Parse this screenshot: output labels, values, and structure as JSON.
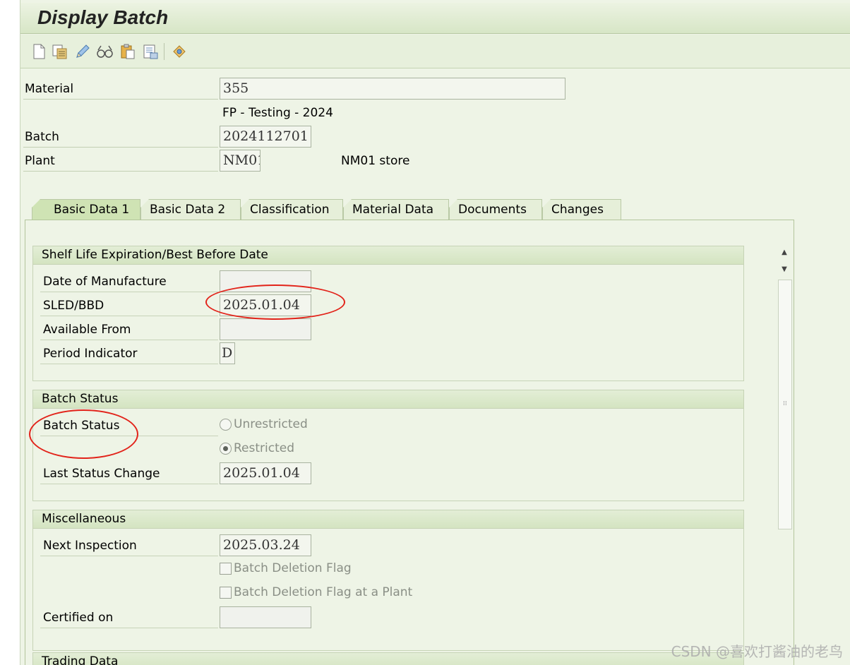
{
  "window": {
    "title": "Display Batch"
  },
  "toolbar": {
    "icons": [
      "new-document-icon",
      "copy-icon",
      "edit-pencil-icon",
      "display-glasses-icon",
      "paste-icon",
      "print-list-icon",
      "settings-icon"
    ]
  },
  "header": {
    "material_label": "Material",
    "material_value": "355",
    "material_desc": "FP - Testing - 2024",
    "batch_label": "Batch",
    "batch_value": "2024112701",
    "plant_label": "Plant",
    "plant_value": "NM01",
    "plant_desc": "NM01 store"
  },
  "tabs": [
    {
      "label": "Basic Data 1",
      "active": true
    },
    {
      "label": "Basic Data 2",
      "active": false
    },
    {
      "label": "Classification",
      "active": false
    },
    {
      "label": "Material Data",
      "active": false
    },
    {
      "label": "Documents",
      "active": false
    },
    {
      "label": "Changes",
      "active": false
    }
  ],
  "shelf_life": {
    "title": "Shelf Life Expiration/Best Before Date",
    "manufacture_label": "Date of Manufacture",
    "manufacture_value": "",
    "sled_label": "SLED/BBD",
    "sled_value": "2025.01.04",
    "available_label": "Available From",
    "available_value": "",
    "period_label": "Period Indicator",
    "period_value": "D"
  },
  "batch_status": {
    "title": "Batch Status",
    "status_label": "Batch Status",
    "unrestricted_label": "Unrestricted",
    "restricted_label": "Restricted",
    "selected": "Restricted",
    "last_change_label": "Last Status Change",
    "last_change_value": "2025.01.04"
  },
  "misc": {
    "title": "Miscellaneous",
    "next_inspection_label": "Next Inspection",
    "next_inspection_value": "2025.03.24",
    "deletion_flag_label": "Batch Deletion Flag",
    "deletion_flag_plant_label": "Batch Deletion Flag at a Plant",
    "certified_label": "Certified on",
    "certified_value": ""
  },
  "trading": {
    "title": "Trading Data"
  },
  "watermark": "CSDN @喜欢打酱油的老鸟",
  "colors": {
    "annotation": "#e2231a",
    "tab_active": "#cfe3b4",
    "background": "#eef4e6"
  }
}
